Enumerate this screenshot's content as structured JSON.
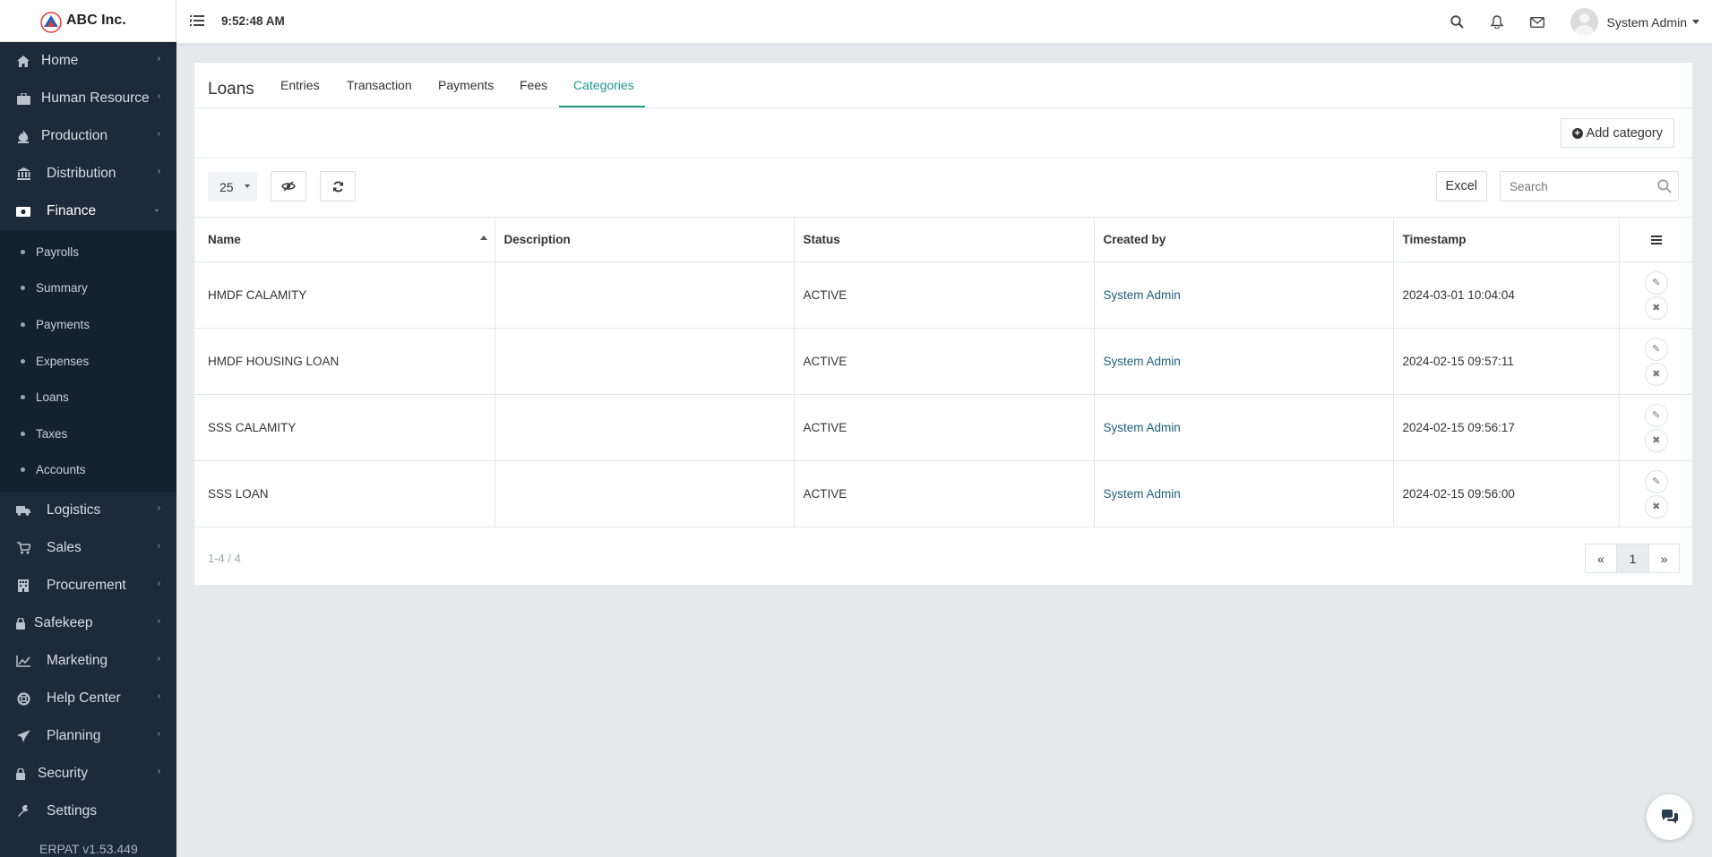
{
  "brand": {
    "name": "ABC Inc."
  },
  "topbar": {
    "clock": "9:52:48 AM",
    "user_name": "System Admin"
  },
  "sidebar": {
    "items": [
      {
        "label": "Home",
        "icon": "home-icon"
      },
      {
        "label": "Human Resource",
        "icon": "briefcase-icon"
      },
      {
        "label": "Production",
        "icon": "fire-icon"
      },
      {
        "label": "Distribution",
        "icon": "bank-icon"
      },
      {
        "label": "Finance",
        "icon": "money-icon"
      },
      {
        "label": "Logistics",
        "icon": "truck-icon"
      },
      {
        "label": "Sales",
        "icon": "cart-icon"
      },
      {
        "label": "Procurement",
        "icon": "building-icon"
      },
      {
        "label": "Safekeep",
        "icon": "lock-icon"
      },
      {
        "label": "Marketing",
        "icon": "chart-line-icon"
      },
      {
        "label": "Help Center",
        "icon": "life-ring-icon"
      },
      {
        "label": "Planning",
        "icon": "paper-plane-icon"
      },
      {
        "label": "Security",
        "icon": "padlock-icon"
      },
      {
        "label": "Settings",
        "icon": "wrench-icon"
      }
    ],
    "finance_sub": [
      "Payrolls",
      "Summary",
      "Payments",
      "Expenses",
      "Loans",
      "Taxes",
      "Accounts"
    ],
    "version": "ERPAT v1.53.449"
  },
  "page": {
    "title": "Loans",
    "tabs": [
      "Entries",
      "Transaction",
      "Payments",
      "Fees",
      "Categories"
    ],
    "add_label": "Add category",
    "page_size": "25",
    "excel_label": "Excel",
    "search_placeholder": "Search"
  },
  "table": {
    "columns": [
      "Name",
      "Description",
      "Status",
      "Created by",
      "Timestamp"
    ],
    "rows": [
      {
        "name": "HMDF CALAMITY",
        "description": "",
        "status": "ACTIVE",
        "created_by": "System Admin",
        "timestamp": "2024-03-01 10:04:04"
      },
      {
        "name": "HMDF HOUSING LOAN",
        "description": "",
        "status": "ACTIVE",
        "created_by": "System Admin",
        "timestamp": "2024-02-15 09:57:11"
      },
      {
        "name": "SSS CALAMITY",
        "description": "",
        "status": "ACTIVE",
        "created_by": "System Admin",
        "timestamp": "2024-02-15 09:56:17"
      },
      {
        "name": "SSS LOAN",
        "description": "",
        "status": "ACTIVE",
        "created_by": "System Admin",
        "timestamp": "2024-02-15 09:56:00"
      }
    ]
  },
  "pagination": {
    "summary": "1-4 / 4",
    "prev": "«",
    "current": "1",
    "next": "»"
  },
  "colors": {
    "accent": "#1c9a8b",
    "sidebar": "#1c2a39",
    "link": "#1b5f7a"
  }
}
